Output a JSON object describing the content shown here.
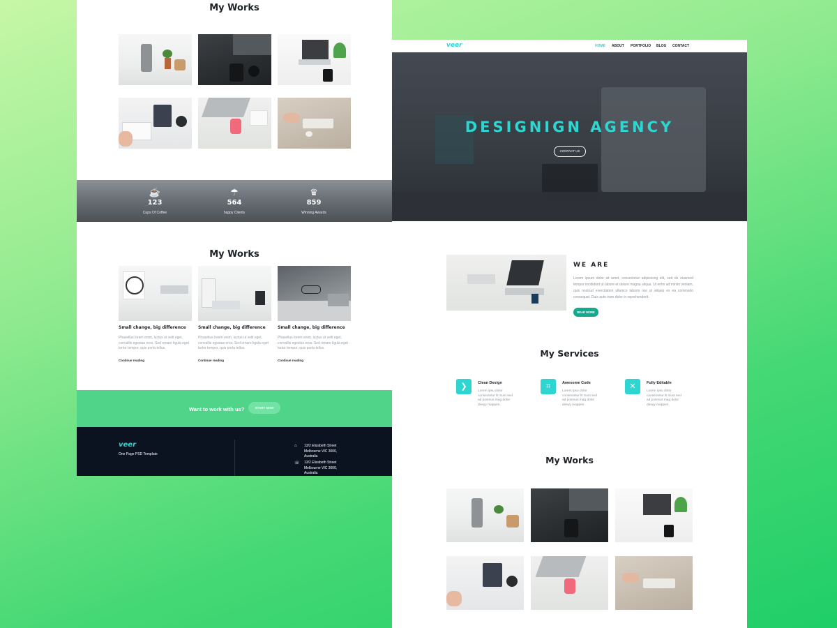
{
  "left_panel": {
    "works_top": {
      "title": "My Works"
    },
    "stats": [
      {
        "icon": "coffee-cup-icon",
        "value": "123",
        "label": "Cups Of Coffee"
      },
      {
        "icon": "umbrella-icon",
        "value": "564",
        "label": "happy Clients"
      },
      {
        "icon": "trophy-icon",
        "value": "859",
        "label": "Winning Awards"
      }
    ],
    "works_blog": {
      "title": "My Works",
      "posts": [
        {
          "title": "Small change, big difference",
          "text": "Phasellus lorem enim, luctus ut velit eget, convallis egestas eros. Sed ornare ligula eget tortor tempor, quis porta tellus.",
          "link": "Continue reading"
        },
        {
          "title": "Small change, big difference",
          "text": "Phasellus lorem enim, luctus ut velit eget, convallis egestas eros. Sed ornare ligula eget tortor tempor, quis porta tellus.",
          "link": "Continue reading"
        },
        {
          "title": "Small change, big difference",
          "text": "Phasellus lorem enim, luctus ut velit eget, convallis egestas eros. Sed ornare ligula eget tortor tempor, quis porta tellus.",
          "link": "Continue reading"
        }
      ]
    },
    "cta": {
      "text": "Want to work with us?",
      "button": "START NOW"
    },
    "footer": {
      "logo": "veer",
      "tagline": "One Page PSD Template",
      "address1": "13/2 Elizabeth Street Melbourne VIC 3000, Australia",
      "address2": "13/2 Elizabeth Street Melbourne VIC 3000, Australia"
    }
  },
  "right_panel": {
    "nav": {
      "logo": "veer",
      "items": [
        "HOME",
        "ABOUT",
        "PORTFOLIO",
        "BLOG",
        "CONTACT"
      ]
    },
    "hero": {
      "title": "DESIGNIGN AGENCY",
      "button": "CONTACT US"
    },
    "about": {
      "title": "WE ARE",
      "text": "Lorem ipsum dolor sit amet, consectetur adipisicing elit, sed do eiusmod tempor incididunt ut labore et dolore magna aliqua. Ut enim ad minim veniam, quis nostrud exercitation ullamco laboris nisi ut aliquip ex ea commodo consequat. Duis aute irure dolor in reprehenderit.",
      "button": "READ MORE"
    },
    "services": {
      "title": "My Services",
      "items": [
        {
          "icon": "design-icon",
          "title": "Clean Design",
          "text": "Lorem ipsu dolor consectetur lit Sunt sed ad posmus mag dolor direyy mappen."
        },
        {
          "icon": "code-icon",
          "title": "Awesome Code",
          "text": "Lorem ipsu dolor consectetur lit Sunt sed ad posmus mag dolor direyy mappen."
        },
        {
          "icon": "tools-icon",
          "title": "Fully Editable",
          "text": "Lorem ipsu dolor consectetur lit Sunt sed ad posmus mag dolor direyy mappen."
        }
      ]
    },
    "works": {
      "title": "My Works"
    }
  },
  "colors": {
    "accent": "#2fd6d1",
    "cta": "#4fd48a",
    "footer": "#0b1220",
    "button_green": "#12a98d"
  }
}
